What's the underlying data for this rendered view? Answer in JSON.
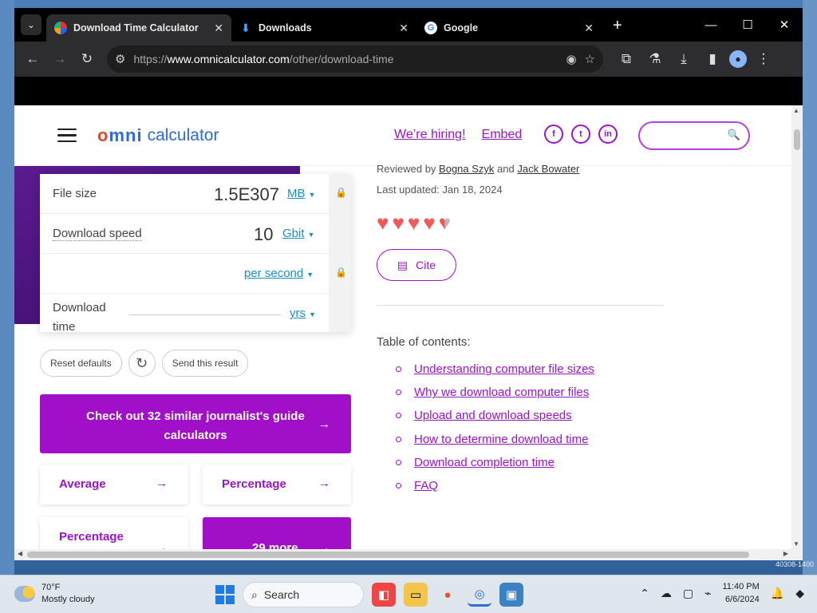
{
  "tabs": [
    {
      "label": "Download Time Calculator",
      "icon": "omni-favicon",
      "active": true
    },
    {
      "label": "Downloads",
      "icon": "download-icon",
      "active": false
    },
    {
      "label": "Google",
      "icon": "google-favicon",
      "active": false
    }
  ],
  "window_controls": {
    "minimize": "—",
    "maximize": "☐",
    "close": "✕"
  },
  "address": {
    "prefix": "https://",
    "host": "www.omnicalculator.com",
    "path": "/other/download-time"
  },
  "site": {
    "logo_omni": "mni",
    "logo_omni_o": "o",
    "logo_calc": "calculator",
    "links": {
      "hiring": "We’re hiring!",
      "embed": "Embed"
    },
    "social": {
      "facebook": "f",
      "twitter": "t",
      "linkedin": "in"
    }
  },
  "calc": {
    "rows": [
      {
        "label": "File size",
        "value": "1.5E307",
        "unit": "MB"
      },
      {
        "label": "Download speed",
        "value": "10",
        "unit": "Gbit"
      },
      {
        "label": "",
        "value": "",
        "unit": "per second"
      },
      {
        "label_line1": "Download",
        "label_line2": "time",
        "value": "",
        "unit": "yrs"
      }
    ],
    "reset_label": "Reset defaults",
    "send_label": "Send this result"
  },
  "cta": {
    "text": "Check out 32 similar journalist's guide calculators",
    "arrow": "→"
  },
  "cards": [
    {
      "label": "Average",
      "arrow": "→"
    },
    {
      "label": "Percentage",
      "arrow": "→"
    },
    {
      "label": "Percentage",
      "arrow": "→"
    },
    {
      "label": "29 more",
      "arrow": "→"
    }
  ],
  "meta": {
    "reviewed_prefix": "Reviewed by ",
    "reviewer1": "Bogna Szyk",
    "and": " and ",
    "reviewer2": "Jack Bowater",
    "updated": "Last updated: Jan 18, 2024",
    "cite_label": "Cite",
    "rating": 4.5
  },
  "toc": {
    "title": "Table of contents:",
    "items": [
      "Understanding computer file sizes",
      "Why we download computer files",
      "Upload and download speeds",
      "How to determine download time",
      "Download completion time",
      "FAQ"
    ]
  },
  "taskbar": {
    "temp": "70°F",
    "weather": "Mostly cloudy",
    "search": "Search",
    "time": "11:40 PM",
    "date": "6/6/2024"
  },
  "desktop": {
    "build": "40308-1400"
  },
  "colors": {
    "accent": "#a20fc9",
    "link": "#9a14c9",
    "unit_link": "#1b8fc2",
    "hero": "#4a137a"
  }
}
